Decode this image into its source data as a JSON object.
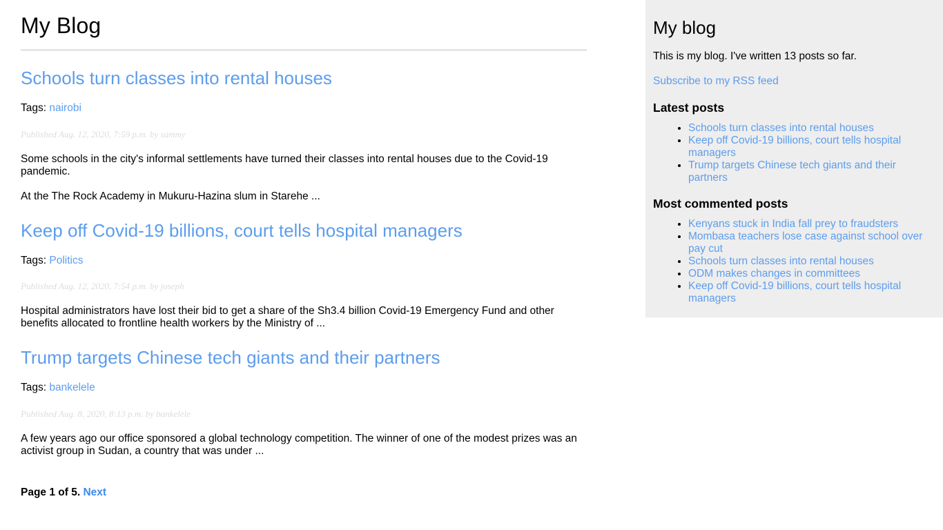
{
  "main": {
    "blog_title": "My Blog",
    "posts": [
      {
        "title": "Schools turn classes into rental houses",
        "tags_label": "Tags:",
        "tags": [
          "nairobi"
        ],
        "meta": "Published Aug. 12, 2020, 7:59 p.m. by sammy",
        "paragraphs": [
          "Some schools in the city's informal settlements have turned their classes into rental houses due to the Covid-19 pandemic.",
          "At the The Rock Academy in Mukuru-Hazina slum in Starehe ..."
        ]
      },
      {
        "title": "Keep off Covid-19 billions, court tells hospital managers",
        "tags_label": "Tags:",
        "tags": [
          "Politics"
        ],
        "meta": "Published Aug. 12, 2020, 7:54 p.m. by joseph",
        "paragraphs": [
          "Hospital administrators have lost their bid to get a share of the Sh3.4 billion Covid-19 Emergency Fund and other benefits allocated to frontline health workers by the Ministry of ..."
        ]
      },
      {
        "title": "Trump targets Chinese tech giants and their partners",
        "tags_label": "Tags:",
        "tags": [
          "bankelele"
        ],
        "meta": "Published Aug. 8, 2020, 8:13 p.m. by bankelele",
        "paragraphs": [
          "A few years ago our office sponsored a global technology competition. The winner of one of the modest prizes was an activist group in Sudan, a country that was under ..."
        ]
      }
    ],
    "pagination": {
      "page_label": "Page 1 of 5.",
      "next_label": "Next"
    }
  },
  "sidebar": {
    "title": "My blog",
    "description": "This is my blog. I've written 13 posts so far.",
    "rss_link": "Subscribe to my RSS feed",
    "latest_heading": "Latest posts",
    "latest_posts": [
      "Schools turn classes into rental houses",
      "Keep off Covid-19 billions, court tells hospital managers",
      "Trump targets Chinese tech giants and their partners"
    ],
    "commented_heading": "Most commented posts",
    "commented_posts": [
      "Kenyans stuck in India fall prey to fraudsters",
      "Mombasa teachers lose case against school over pay cut",
      "Schools turn classes into rental houses",
      "ODM makes changes in committees",
      "Keep off Covid-19 billions, court tells hospital managers"
    ]
  },
  "colors": {
    "link": "#5c9ded",
    "sidebar_bg": "#eeeeee",
    "meta_text": "#dcdcdc",
    "rule": "#bfbfbf"
  }
}
